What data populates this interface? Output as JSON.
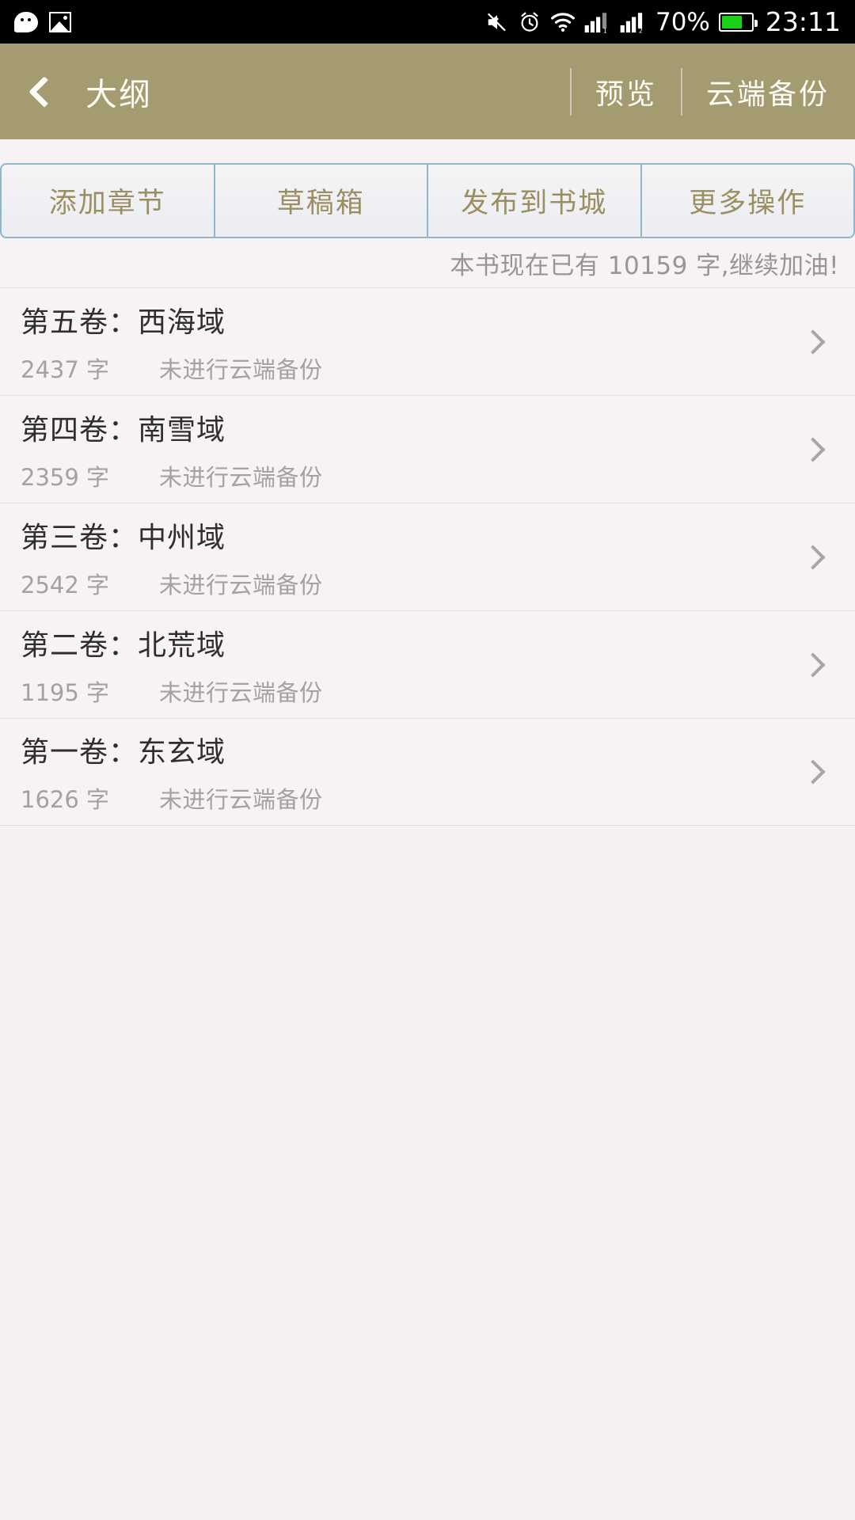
{
  "status_bar": {
    "icons_left": [
      "wechat-icon",
      "gallery-icon"
    ],
    "icons_right": [
      "mute-icon",
      "alarm-icon",
      "wifi-icon",
      "signal-sim1-icon",
      "signal-sim2-icon"
    ],
    "battery_percent": "70%",
    "battery_level": 70,
    "clock": "23:11"
  },
  "header": {
    "back_icon": "back-chevron-icon",
    "title": "大纲",
    "actions": [
      {
        "label": "预览",
        "name": "preview-action"
      },
      {
        "label": "云端备份",
        "name": "cloud-backup-action"
      }
    ]
  },
  "toolbar": {
    "buttons": [
      {
        "label": "添加章节",
        "name": "add-chapter-button"
      },
      {
        "label": "草稿箱",
        "name": "draft-box-button"
      },
      {
        "label": "发布到书城",
        "name": "publish-to-store-button"
      },
      {
        "label": "更多操作",
        "name": "more-actions-button"
      }
    ]
  },
  "status_line": {
    "text": "本书现在已有 10159 字,继续加油!",
    "total_words": 10159
  },
  "volumes": [
    {
      "title": "第五卷：西海域",
      "word_count": "2437 字",
      "backup_status": "未进行云端备份"
    },
    {
      "title": "第四卷：南雪域",
      "word_count": "2359 字",
      "backup_status": "未进行云端备份"
    },
    {
      "title": "第三卷：中州域",
      "word_count": "2542 字",
      "backup_status": "未进行云端备份"
    },
    {
      "title": "第二卷：北荒域",
      "word_count": "1195 字",
      "backup_status": "未进行云端备份"
    },
    {
      "title": "第一卷：东玄域",
      "word_count": "1626 字",
      "backup_status": "未进行云端备份"
    }
  ],
  "colors": {
    "header_bg": "#a59b71",
    "page_bg": "#f5f1f3",
    "button_border": "#8fb6cc",
    "button_text": "#9b8f62",
    "title_text": "#2e2e2e",
    "muted_text": "#a5a0a4",
    "battery_green": "#19d219"
  }
}
